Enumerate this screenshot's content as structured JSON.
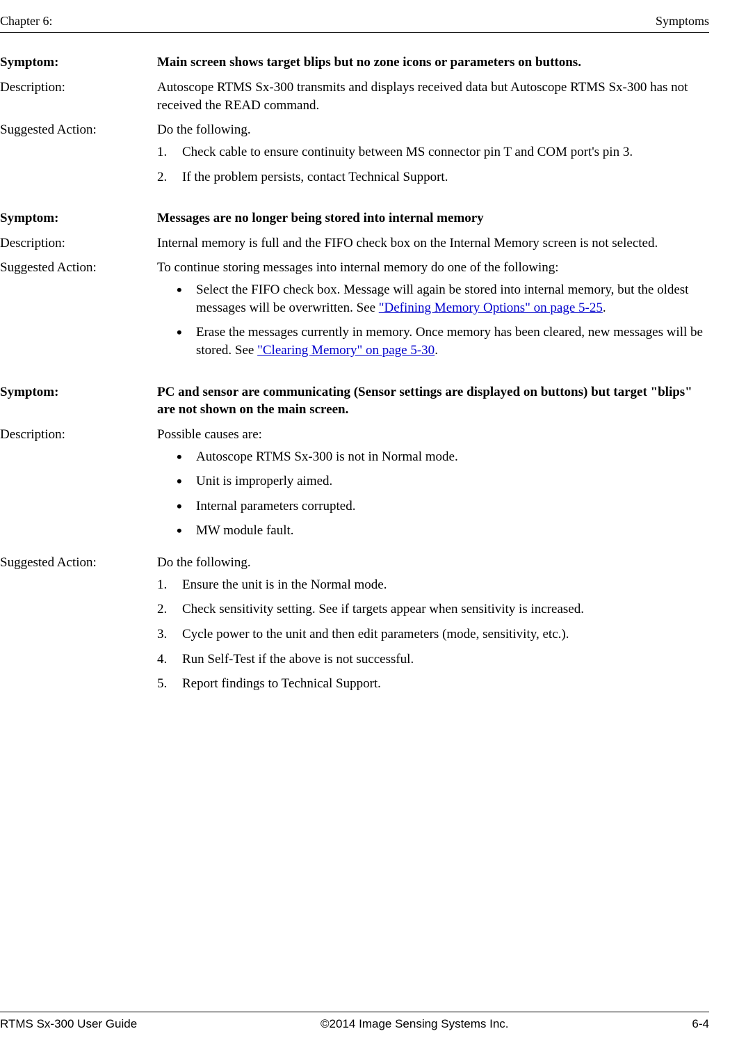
{
  "header": {
    "left": "Chapter 6:",
    "right": "Symptoms"
  },
  "footer": {
    "left": "RTMS Sx-300 User Guide",
    "center": "©2014 Image Sensing Systems Inc.",
    "right": "6-4"
  },
  "labels": {
    "symptom": "Symptom:",
    "description": "Description:",
    "suggested_action": "Suggested Action:"
  },
  "s1": {
    "symptom": "Main screen shows target blips but no zone icons or parameters on buttons.",
    "description": "Autoscope RTMS Sx-300 transmits and displays received data but Autoscope RTMS Sx-300 has not received the READ command.",
    "action_intro": "Do the following.",
    "steps": {
      "1": "Check cable to ensure continuity between MS connector pin T and COM port's pin 3.",
      "2": "If the problem persists, contact Technical Support."
    }
  },
  "s2": {
    "symptom": "Messages are no longer being stored into internal memory",
    "description": "Internal memory is full and the FIFO check box on the Internal Memory screen is not selected.",
    "action_intro": "To continue storing messages into internal memory do one of the following:",
    "bullets": {
      "1a": "Select the FIFO check box. Message will again be stored into internal memory, but the oldest messages will be overwritten. See ",
      "1link": "\"Defining Memory Options\" on page 5-25",
      "1b": ".",
      "2a": "Erase the messages currently in memory. Once memory has been cleared, new messages will be stored. See ",
      "2link": "\"Clearing Memory\" on page 5-30",
      "2b": "."
    }
  },
  "s3": {
    "symptom": "PC and sensor are communicating (Sensor settings are displayed on buttons) but target \"blips\" are not shown on the main screen.",
    "desc_intro": "Possible causes are:",
    "causes": {
      "1": "Autoscope RTMS Sx-300 is not in Normal mode.",
      "2": "Unit is improperly aimed.",
      "3": "Internal parameters corrupted.",
      "4": "MW module fault."
    },
    "action_intro": "Do the following.",
    "steps": {
      "1": "Ensure the unit is in the Normal mode.",
      "2": "Check sensitivity setting. See if targets appear when sensitivity is increased.",
      "3": "Cycle power to the unit and then edit parameters (mode, sensitivity, etc.).",
      "4": "Run Self-Test if the above is not successful.",
      "5": "Report findings to Technical Support."
    }
  }
}
